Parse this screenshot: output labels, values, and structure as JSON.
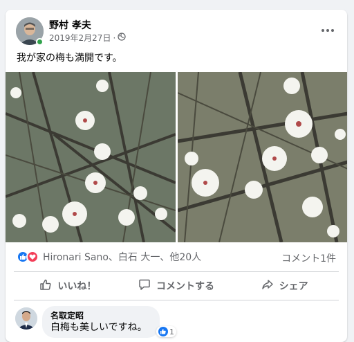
{
  "post": {
    "author": "野村 孝夫",
    "date": "2019年2月27日",
    "separator": "·",
    "privacy_icon": "globe-icon",
    "text": "我が家の梅も満開です。"
  },
  "reactions": {
    "summary": "Hironari Sano、白石 大一、他20人",
    "comments_count": "コメント1件",
    "icons": [
      "like-icon",
      "love-icon"
    ],
    "colors": {
      "like": "#1877f2",
      "love": "#f33e58"
    }
  },
  "actions": {
    "like_label": "いいね！",
    "comment_label": "コメントする",
    "share_label": "シェア"
  },
  "comment": {
    "author": "名取定昭",
    "text": "白梅も美しいですね。",
    "like_count": "1"
  }
}
